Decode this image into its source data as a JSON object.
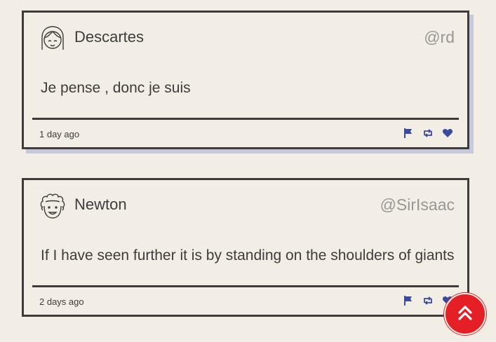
{
  "tweets": [
    {
      "name": "Descartes",
      "handle": "@rd",
      "message": "Je pense , donc je suis",
      "time": "1 day ago",
      "avatar_icon": "girl-face-avatar-icon"
    },
    {
      "name": "Newton",
      "handle": "@SirIsaac",
      "message": "If I have seen further it is by standing on the shoulders of giants",
      "time": "2 days ago",
      "avatar_icon": "curly-hair-face-avatar-icon"
    }
  ],
  "actions": [
    "flag-icon",
    "retweet-icon",
    "heart-icon"
  ],
  "scroll_top_icon": "double-chevron-up-icon",
  "colors": {
    "background": "#f2eee6",
    "border": "#3f3b3b",
    "shadow": "#c6c8dc",
    "handle": "#9a9696",
    "action": "#3a4aa0",
    "scroll_button": "#e41f25"
  }
}
